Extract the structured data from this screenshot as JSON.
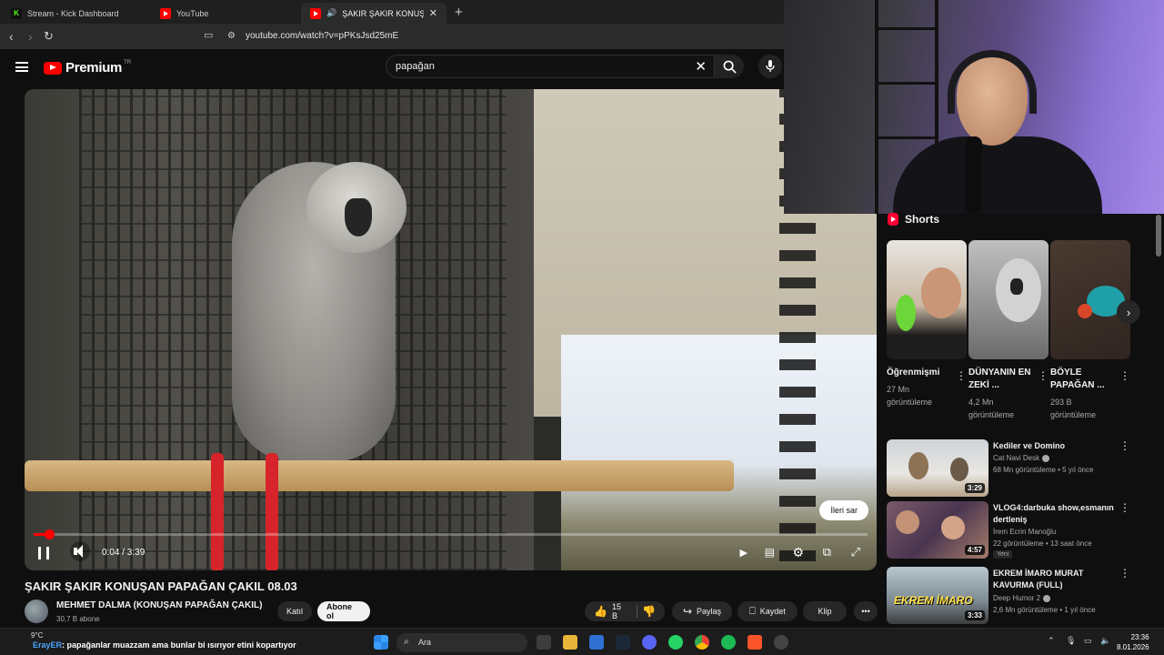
{
  "tabs": [
    {
      "label": "Stream - Kick Dashboard",
      "favicon": "kick-icon"
    },
    {
      "label": "YouTube",
      "favicon": "youtube-icon"
    },
    {
      "label": "ŞAKIR ŞAKIR KONUŞAN PAPA",
      "favicon": "youtube-icon",
      "active": true
    }
  ],
  "address": {
    "url": "youtube.com/watch?v=pPKsJsd25mE"
  },
  "youtube": {
    "brand": "Premium",
    "brand_sup": "TR",
    "search_query": "papağan"
  },
  "player": {
    "time": "0:04 / 3:39",
    "progress_fraction": 0.018,
    "skip_label": "İleri sar"
  },
  "video": {
    "title": "ŞAKIR ŞAKIR KONUŞAN PAPAĞAN ÇAKIL 08.03",
    "channel": "MEHMET DALMA (KONUŞAN PAPAĞAN ÇAKIL)",
    "subscribers": "30,7 B abone",
    "join_label": "Katıl",
    "subscribe_label": "Abone ol",
    "likes": "15 B",
    "share_label": "Paylaş",
    "save_label": "Kaydet",
    "clip_label": "Klip"
  },
  "shorts": {
    "header": "Shorts",
    "items": [
      {
        "title": "Öğrenmişmi",
        "views_num": "27 Mn",
        "views_word": "görüntüleme"
      },
      {
        "title": "DÜNYANIN EN ZEKİ ...",
        "views_num": "4,2 Mn",
        "views_word": "görüntüleme"
      },
      {
        "title": "BÖYLE PAPAĞAN ...",
        "views_num": "293 B",
        "views_word": "görüntüleme"
      }
    ]
  },
  "recommendations": [
    {
      "title": "Kediler ve Domino",
      "channel": "Cat Navi Desk",
      "meta": "68 Mn görüntüleme • 5 yıl önce",
      "duration": "3:29"
    },
    {
      "title": "VLOG4:darbuka show,esmanın dertleniş",
      "channel": "İrem Ecrin Manoğlu",
      "meta": "22 görüntüleme • 13 saat önce",
      "duration": "4:57",
      "badge": "Yeni"
    },
    {
      "title": "EKREM İMARO MURAT KAVURMA (FULL)",
      "channel": "Deep Humor 2",
      "meta": "2,6 Mn görüntüleme • 1 yıl önce",
      "duration": "3:33",
      "thumb_text": "EKREM İMARO"
    }
  ],
  "taskbar": {
    "temperature": "9°C",
    "ticker_user": "ErayER",
    "ticker_text": ": papağanlar muazzam ama bunlar bi ısırıyor etini kopartıyor",
    "search_label": "Ara",
    "time": "23:36",
    "date": "8.01.2026"
  }
}
